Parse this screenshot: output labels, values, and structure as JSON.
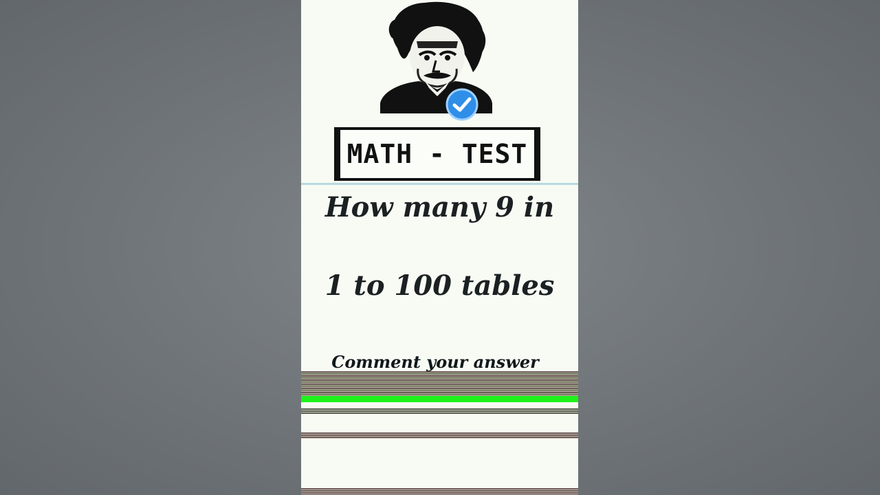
{
  "video": {
    "title_card": "MATH - TEST",
    "question_line_1": "How many 9 in",
    "question_line_2": "1 to 100 tables",
    "call_to_action": "Comment your answer"
  },
  "icons": {
    "portrait": "scientist-portrait-icon",
    "badge": "verified-check-icon"
  },
  "colors": {
    "backdrop": "#6f7478",
    "card_background": "#f7fbf4",
    "text": "#1b2022",
    "badge": "#2f8ee8",
    "glitch_green": "#1ef21a"
  }
}
